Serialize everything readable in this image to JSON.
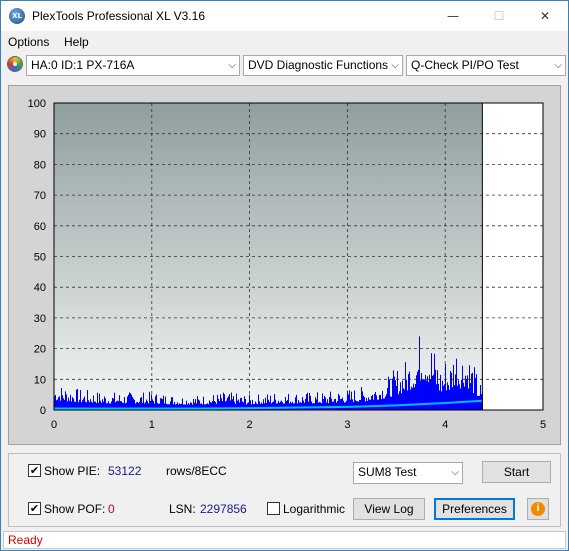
{
  "window": {
    "title": "PlexTools Professional XL V3.16",
    "icon_text": "XL"
  },
  "titlebar_buttons": {
    "minimize": "—",
    "maximize": "☐",
    "close": "✕"
  },
  "menu": {
    "items": [
      "Options",
      "Help"
    ]
  },
  "toolbar": {
    "drive": "HA:0 ID:1  PX-716A",
    "function": "DVD Diagnostic Functions",
    "test": "Q-Check PI/PO Test",
    "arrow": "⌵"
  },
  "chart_data": {
    "type": "bar",
    "x_label": "",
    "y_label": "",
    "xlim": [
      0,
      5
    ],
    "ylim": [
      0,
      100
    ],
    "x_ticks": [
      "0",
      "1",
      "2",
      "3",
      "4",
      "5"
    ],
    "y_ticks": [
      "0",
      "10",
      "20",
      "30",
      "40",
      "50",
      "60",
      "70",
      "80",
      "90",
      "100"
    ],
    "grid": true,
    "data_end_x": 4.38,
    "series": [
      {
        "name": "PIE",
        "color": "#0000ff",
        "x": [
          0.0,
          0.25,
          0.5,
          0.75,
          1.0,
          1.25,
          1.5,
          1.75,
          2.0,
          2.25,
          2.5,
          2.75,
          3.0,
          3.2,
          3.4,
          3.5,
          3.6,
          3.7,
          3.75,
          3.8,
          3.85,
          3.9,
          3.95,
          4.0,
          4.05,
          4.1,
          4.15,
          4.2,
          4.25,
          4.3,
          4.35,
          4.38
        ],
        "y": [
          9,
          7,
          6,
          6,
          6,
          5,
          5,
          6,
          5,
          6,
          6,
          6,
          7,
          8,
          11,
          14,
          17,
          22,
          28,
          27,
          24,
          20,
          15,
          18,
          17,
          24,
          20,
          22,
          19,
          14,
          10,
          6
        ]
      },
      {
        "name": "PI8 sum",
        "color": "#00bfff",
        "x": [
          0.0,
          0.5,
          1.0,
          1.5,
          2.0,
          2.5,
          3.0,
          3.5,
          4.0,
          4.38
        ],
        "y": [
          0.5,
          0.5,
          0.5,
          0.5,
          0.6,
          0.8,
          1.0,
          1.5,
          2.3,
          3.0
        ]
      }
    ]
  },
  "controls": {
    "show_pie_label": "Show PIE:",
    "show_pie_checked": "✔",
    "pie_value": "53122",
    "pie_unit": "rows/8ECC",
    "show_pof_label": "Show POF:",
    "show_pof_checked": "✔",
    "pof_value": "0",
    "lsn_label": "LSN:",
    "lsn_value": "2297856",
    "log_label": "Logarithmic",
    "log_checked": "",
    "test_select": "SUM8 Test",
    "start_button": "Start",
    "view_log_button": "View Log",
    "preferences_button": "Preferences",
    "info_icon": "i"
  },
  "status": {
    "text": "Ready"
  }
}
